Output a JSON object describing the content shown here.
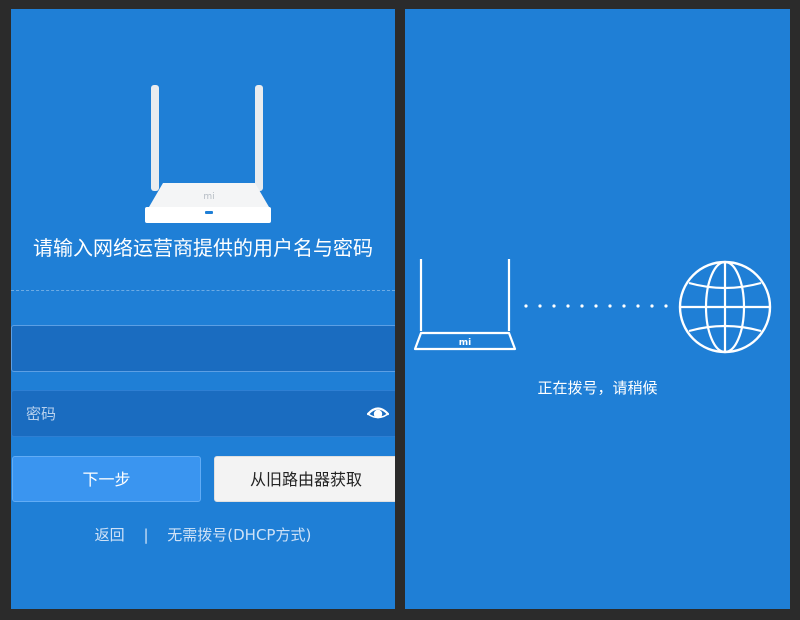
{
  "setup": {
    "router_brand_mark": "mi",
    "prompt": "请输入网络运营商提供的用户名与密码",
    "username": {
      "value": "",
      "placeholder": ""
    },
    "password": {
      "value": "",
      "placeholder": "密码"
    },
    "next_label": "下一步",
    "fetch_from_old_router_label": "从旧路由器获取",
    "back_link": "返回",
    "separator": "|",
    "no_dial_link": "无需拨号(DHCP方式)"
  },
  "dialing": {
    "router_brand_mark": "mi",
    "status": "正在拨号，请稍候"
  },
  "colors": {
    "panel_bg": "#1f7fd6",
    "primary_button": "#3a95f0",
    "secondary_button": "#f3f3f3",
    "frame": "#2b2b2b"
  },
  "icons": {
    "router": "router-icon",
    "eye": "eye-icon",
    "globe": "globe-icon"
  }
}
